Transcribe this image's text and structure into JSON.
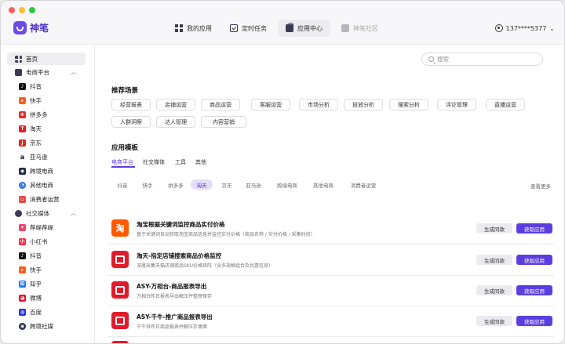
{
  "app": {
    "name": "神笔",
    "logo_icon": "pen-logo-icon"
  },
  "topnav": [
    {
      "label": "我的应用",
      "icon": "grid-icon"
    },
    {
      "label": "定时任务",
      "icon": "calendar-check-icon"
    },
    {
      "label": "应用中心",
      "icon": "shopping-bag-icon",
      "active": true
    },
    {
      "label": "神笔社区",
      "icon": "chat-icon",
      "disabled": true
    }
  ],
  "user": {
    "phone": "137****5377",
    "icon": "user-circle-icon"
  },
  "sidebar": {
    "home": "首页",
    "groups": [
      {
        "label": "电商平台",
        "items": [
          "抖音",
          "快手",
          "拼多多",
          "淘天",
          "京东",
          "亚马逊",
          "跨境电商",
          "其他电商",
          "消费者运营"
        ]
      },
      {
        "label": "社交媒体",
        "items": [
          "荐缇荐缇",
          "小红书",
          "抖音",
          "快手",
          "知乎",
          "微博",
          "百度",
          "跨境社媒"
        ]
      }
    ]
  },
  "search": {
    "placeholder": "搜索"
  },
  "recommend": {
    "title": "推荐场景",
    "chips": [
      "经营报表",
      "店铺运营",
      "商品运营",
      "客服运营",
      "市场分析",
      "投放分析",
      "搜索分析",
      "评论管理",
      "直播运营",
      "人群洞察",
      "达人管理",
      "内容营销"
    ]
  },
  "templates": {
    "title": "应用模板",
    "tabs": [
      "电商平台",
      "社交媒体",
      "工具",
      "其他"
    ],
    "platforms": [
      "抖音",
      "快手",
      "拼多多",
      "淘天",
      "京东",
      "亚马逊",
      "跨境电商",
      "其他电商",
      "消费者运营"
    ],
    "more": "查看更多",
    "rows": [
      {
        "icon": "taobao-icon",
        "glyph": "淘",
        "title": "淘宝根据关键词监控商品实付价格",
        "desc": "基于关键词自动获取淘宝商品信息并监控实付价格（商品名称 / 实付价格 / 采集时间）"
      },
      {
        "icon": "tmall-icon",
        "title": "淘天-指定店铺搜索商品价格监控",
        "desc": "深度采集天猫店铺商品SKU价格矩阵（含多规格组合及优惠信息）"
      },
      {
        "icon": "tmall-icon",
        "title": "ASY-万相台-商品报表导出",
        "desc": "万相台昨日报表导出解压并整理保存"
      },
      {
        "icon": "tmall-icon",
        "title": "ASY-千牛-推广商品报表导出",
        "desc": "千牛导昨日商品报表并解压存桌面"
      }
    ],
    "btn_similar": "生成同款",
    "btn_get": "获取应用"
  },
  "colors": {
    "accent": "#5b3ee0",
    "taobao": "#ff5a00",
    "tmall": "#e21b2b"
  }
}
